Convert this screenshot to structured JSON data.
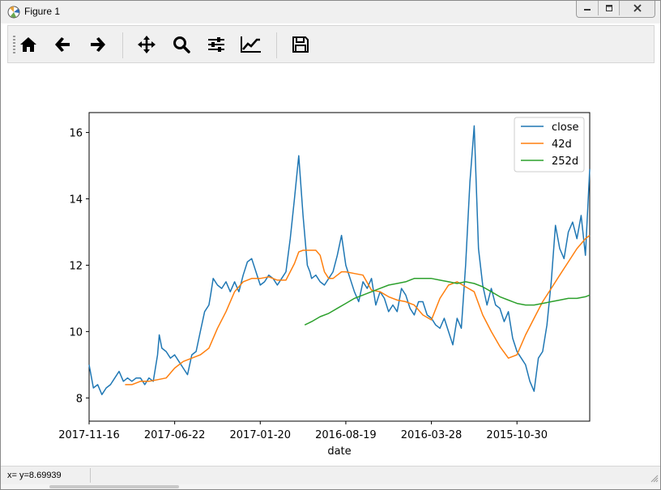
{
  "window": {
    "title": "Figure 1"
  },
  "toolbar": {
    "buttons": [
      {
        "name": "home-button",
        "icon": "home-icon"
      },
      {
        "name": "back-button",
        "icon": "arrow-left-icon"
      },
      {
        "name": "forward-button",
        "icon": "arrow-right-icon"
      },
      {
        "name": "pan-button",
        "icon": "move-icon"
      },
      {
        "name": "zoom-button",
        "icon": "magnifier-icon"
      },
      {
        "name": "subplots-button",
        "icon": "sliders-icon"
      },
      {
        "name": "edit-axes-button",
        "icon": "line-chart-icon"
      },
      {
        "name": "save-button",
        "icon": "floppy-disk-icon"
      }
    ]
  },
  "status": {
    "text": "x= y=8.69939"
  },
  "colors": {
    "close": "#1f77b4",
    "ma42": "#ff7f0e",
    "ma252": "#2ca02c"
  },
  "chart_data": {
    "type": "line",
    "xlabel": "date",
    "ylabel": "",
    "ylim": [
      7.3,
      16.6
    ],
    "yticks": [
      8,
      10,
      12,
      14,
      16
    ],
    "xtick_labels": [
      "2017-11-16",
      "2017-06-22",
      "2017-01-20",
      "2016-08-19",
      "2016-03-28",
      "2015-10-30"
    ],
    "xtick_index": [
      0,
      100,
      200,
      300,
      400,
      500
    ],
    "xlim": [
      0,
      585
    ],
    "legend": {
      "placement": "top-right",
      "entries": [
        "close",
        "42d",
        "252d"
      ]
    },
    "grid": false,
    "series": [
      {
        "name": "close",
        "x": [
          0,
          5,
          10,
          15,
          20,
          25,
          30,
          35,
          40,
          45,
          50,
          55,
          60,
          65,
          70,
          75,
          80,
          82,
          85,
          90,
          95,
          100,
          105,
          110,
          115,
          120,
          125,
          130,
          135,
          140,
          142,
          145,
          150,
          155,
          160,
          165,
          170,
          175,
          180,
          185,
          190,
          195,
          200,
          205,
          210,
          215,
          220,
          225,
          230,
          235,
          240,
          245,
          250,
          253,
          255,
          258,
          260,
          265,
          270,
          275,
          280,
          285,
          290,
          295,
          300,
          305,
          310,
          315,
          320,
          325,
          330,
          335,
          340,
          345,
          350,
          355,
          360,
          365,
          370,
          375,
          380,
          385,
          390,
          395,
          400,
          405,
          410,
          415,
          420,
          425,
          430,
          435,
          440,
          445,
          450,
          455,
          460,
          465,
          470,
          475,
          480,
          485,
          490,
          495,
          500,
          505,
          510,
          515,
          520,
          525,
          530,
          535,
          540,
          545,
          550,
          555,
          560,
          565,
          570,
          575,
          580,
          585
        ],
        "y": [
          9.0,
          8.3,
          8.4,
          8.1,
          8.3,
          8.4,
          8.6,
          8.8,
          8.5,
          8.6,
          8.5,
          8.6,
          8.6,
          8.4,
          8.6,
          8.5,
          9.3,
          9.9,
          9.5,
          9.4,
          9.2,
          9.3,
          9.1,
          8.9,
          8.7,
          9.3,
          9.4,
          10.0,
          10.6,
          10.8,
          11.1,
          11.6,
          11.4,
          11.3,
          11.5,
          11.2,
          11.5,
          11.2,
          11.7,
          12.1,
          12.2,
          11.8,
          11.4,
          11.5,
          11.7,
          11.6,
          11.4,
          11.6,
          11.8,
          12.8,
          14.0,
          15.3,
          13.5,
          12.6,
          12.0,
          11.8,
          11.6,
          11.7,
          11.5,
          11.4,
          11.6,
          11.8,
          12.3,
          12.9,
          12.0,
          11.6,
          11.2,
          10.9,
          11.5,
          11.3,
          11.6,
          10.8,
          11.2,
          11.0,
          10.6,
          10.8,
          10.6,
          11.3,
          11.1,
          10.7,
          10.5,
          10.9,
          10.9,
          10.5,
          10.4,
          10.2,
          10.1,
          10.4,
          10.0,
          9.6,
          10.4,
          10.1,
          12.0,
          14.5,
          16.2,
          12.5,
          11.4,
          10.8,
          11.3,
          10.8,
          10.7,
          10.3,
          10.6,
          9.8,
          9.4,
          9.2,
          9.0,
          8.5,
          8.2,
          9.2,
          9.4,
          10.2,
          11.5,
          13.2,
          12.5,
          12.2,
          13.0,
          13.3,
          12.8,
          13.5,
          12.3,
          14.9
        ]
      },
      {
        "name": "42d",
        "x": [
          42,
          50,
          60,
          70,
          80,
          90,
          100,
          110,
          120,
          130,
          140,
          150,
          160,
          170,
          180,
          190,
          200,
          210,
          220,
          230,
          240,
          245,
          250,
          255,
          260,
          265,
          270,
          275,
          280,
          285,
          290,
          295,
          300,
          310,
          320,
          330,
          340,
          350,
          360,
          370,
          380,
          390,
          400,
          410,
          420,
          430,
          440,
          450,
          460,
          470,
          480,
          490,
          500,
          510,
          520,
          530,
          540,
          550,
          560,
          570,
          580,
          585
        ],
        "y": [
          8.4,
          8.4,
          8.5,
          8.5,
          8.55,
          8.6,
          8.9,
          9.1,
          9.2,
          9.3,
          9.5,
          10.1,
          10.6,
          11.2,
          11.5,
          11.6,
          11.6,
          11.65,
          11.55,
          11.55,
          12.05,
          12.4,
          12.45,
          12.45,
          12.45,
          12.45,
          12.3,
          11.8,
          11.6,
          11.6,
          11.7,
          11.8,
          11.8,
          11.75,
          11.7,
          11.25,
          11.2,
          11.05,
          10.95,
          10.9,
          10.8,
          10.5,
          10.35,
          11.0,
          11.4,
          11.5,
          11.35,
          11.2,
          10.5,
          10.0,
          9.55,
          9.2,
          9.3,
          9.9,
          10.4,
          10.9,
          11.3,
          11.7,
          12.1,
          12.5,
          12.8,
          12.9
        ]
      },
      {
        "name": "252d",
        "x": [
          252,
          260,
          270,
          280,
          290,
          300,
          310,
          320,
          330,
          340,
          350,
          360,
          370,
          380,
          390,
          400,
          410,
          420,
          430,
          440,
          450,
          460,
          470,
          480,
          490,
          500,
          510,
          520,
          530,
          540,
          550,
          560,
          570,
          580,
          585
        ],
        "y": [
          10.2,
          10.3,
          10.45,
          10.55,
          10.7,
          10.85,
          11.0,
          11.1,
          11.2,
          11.3,
          11.4,
          11.45,
          11.5,
          11.6,
          11.6,
          11.6,
          11.55,
          11.5,
          11.45,
          11.5,
          11.45,
          11.35,
          11.2,
          11.05,
          10.95,
          10.85,
          10.8,
          10.8,
          10.85,
          10.9,
          10.95,
          11.0,
          11.0,
          11.05,
          11.1
        ]
      }
    ]
  }
}
